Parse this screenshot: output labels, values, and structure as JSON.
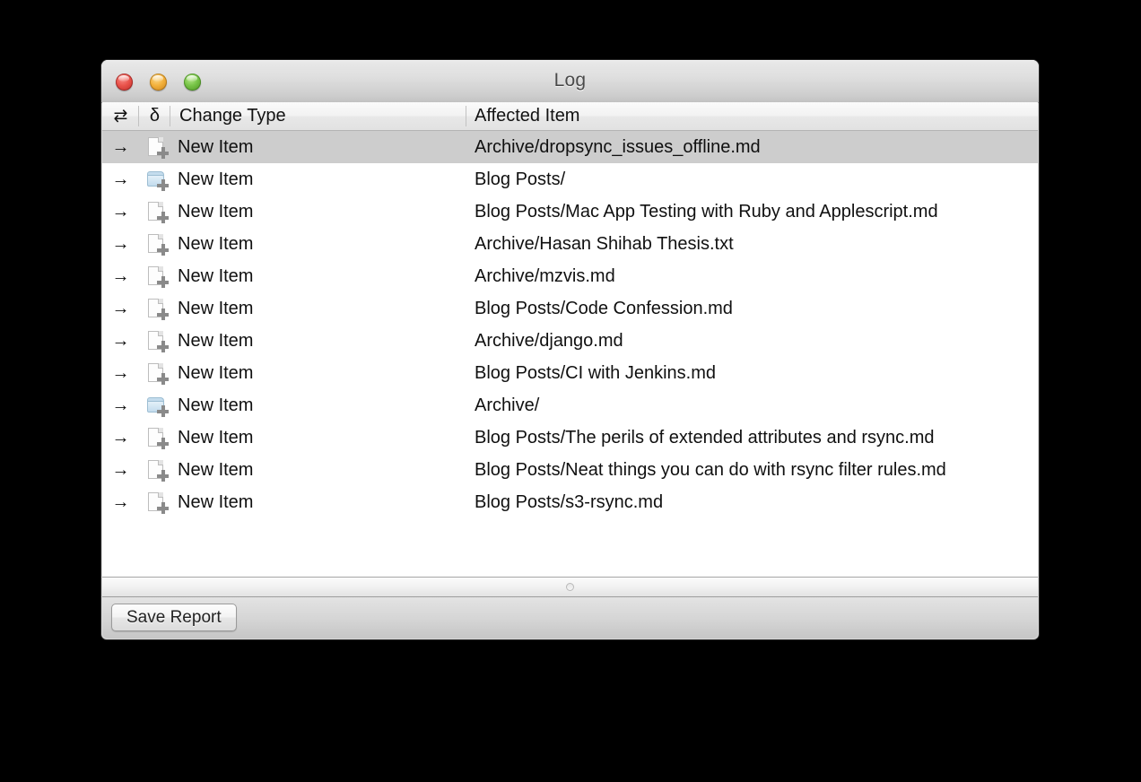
{
  "window": {
    "title": "Log",
    "controls": {
      "close": "close-button",
      "minimize": "minimize-button",
      "zoom": "zoom-button"
    }
  },
  "table": {
    "headers": {
      "direction": "⇄",
      "delta": "δ",
      "change_type": "Change Type",
      "affected_item": "Affected Item"
    },
    "rows": [
      {
        "direction": "→",
        "icon": "file-add-icon",
        "change_type": "New Item",
        "affected_item": "Archive/dropsync_issues_offline.md",
        "selected": true
      },
      {
        "direction": "→",
        "icon": "folder-add-icon",
        "change_type": "New Item",
        "affected_item": "Blog Posts/",
        "selected": false
      },
      {
        "direction": "→",
        "icon": "file-add-icon",
        "change_type": "New Item",
        "affected_item": "Blog Posts/Mac App Testing with Ruby and Applescript.md",
        "selected": false
      },
      {
        "direction": "→",
        "icon": "file-add-icon",
        "change_type": "New Item",
        "affected_item": "Archive/Hasan Shihab Thesis.txt",
        "selected": false
      },
      {
        "direction": "→",
        "icon": "file-add-icon",
        "change_type": "New Item",
        "affected_item": "Archive/mzvis.md",
        "selected": false
      },
      {
        "direction": "→",
        "icon": "file-add-icon",
        "change_type": "New Item",
        "affected_item": "Blog Posts/Code Confession.md",
        "selected": false
      },
      {
        "direction": "→",
        "icon": "file-add-icon",
        "change_type": "New Item",
        "affected_item": "Archive/django.md",
        "selected": false
      },
      {
        "direction": "→",
        "icon": "file-add-icon",
        "change_type": "New Item",
        "affected_item": "Blog Posts/CI with Jenkins.md",
        "selected": false
      },
      {
        "direction": "→",
        "icon": "folder-add-icon",
        "change_type": "New Item",
        "affected_item": "Archive/",
        "selected": false
      },
      {
        "direction": "→",
        "icon": "file-add-icon",
        "change_type": "New Item",
        "affected_item": "Blog Posts/The perils of extended attributes and rsync.md",
        "selected": false
      },
      {
        "direction": "→",
        "icon": "file-add-icon",
        "change_type": "New Item",
        "affected_item": "Blog Posts/Neat things you can do with rsync filter rules.md",
        "selected": false
      },
      {
        "direction": "→",
        "icon": "file-add-icon",
        "change_type": "New Item",
        "affected_item": "Blog Posts/s3-rsync.md",
        "selected": false
      }
    ]
  },
  "footer": {
    "save_label": "Save Report",
    "grip": "resize-grip"
  },
  "colors": {
    "selection": "#cdcdcd",
    "close": "#e9534b",
    "minimize": "#f3b13c",
    "zoom": "#77c447",
    "folder": "#c3dcee",
    "badge": "#8a8a8a"
  }
}
